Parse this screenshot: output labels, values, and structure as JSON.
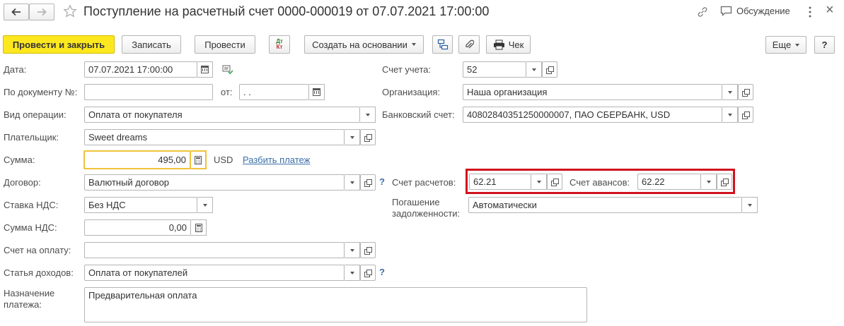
{
  "header": {
    "title": "Поступление на расчетный счет 0000-000019 от 07.07.2021 17:00:00",
    "discussion_label": "Обсуждение",
    "close_label": "×"
  },
  "toolbar": {
    "post_close_label": "Провести и закрыть",
    "save_label": "Записать",
    "post_label": "Провести",
    "dt_label": "Дт",
    "kt_label": "Кт",
    "create_based_label": "Создать на основании",
    "check_label": "Чек",
    "more_label": "Еще",
    "help_label": "?"
  },
  "left": {
    "date_label": "Дата:",
    "date_value": "07.07.2021 17:00:00",
    "doc_no_label": "По документу №:",
    "doc_no_value": "",
    "from_label": "от:",
    "from_value": " .  .",
    "op_type_label": "Вид операции:",
    "op_type_value": "Оплата от покупателя",
    "payer_label": "Плательщик:",
    "payer_value": "Sweet dreams",
    "sum_label": "Сумма:",
    "sum_value": "495,00",
    "currency": "USD",
    "split_link": "Разбить платеж",
    "contract_label": "Договор:",
    "contract_value": "Валютный договор",
    "vat_rate_label": "Ставка НДС:",
    "vat_rate_value": "Без НДС",
    "vat_sum_label": "Сумма НДС:",
    "vat_sum_value": "0,00",
    "invoice_label": "Счет на оплату:",
    "invoice_value": "",
    "income_label": "Статья доходов:",
    "income_value": "Оплата от покупателей",
    "purpose_label_1": "Назначение",
    "purpose_label_2": "платежа:",
    "purpose_value": "Предварительная оплата",
    "help_q": "?"
  },
  "right": {
    "account_label": "Счет учета:",
    "account_value": "52",
    "org_label": "Организация:",
    "org_value": "Наша организация",
    "bank_label": "Банковский счет:",
    "bank_value": "40802840351250000007, ПАО СБЕРБАНК, USD",
    "settle_label": "Счет расчетов:",
    "settle_value": "62.21",
    "advance_label": "Счет авансов:",
    "advance_value": "62.22",
    "repay_label_1": "Погашение",
    "repay_label_2": "задолженности:",
    "repay_value": "Автоматически"
  },
  "colors": {
    "primary_button": "#fde71f",
    "highlight_frame": "#d0131e",
    "focus_border": "#f0c23a",
    "link": "#3a6ea8"
  }
}
